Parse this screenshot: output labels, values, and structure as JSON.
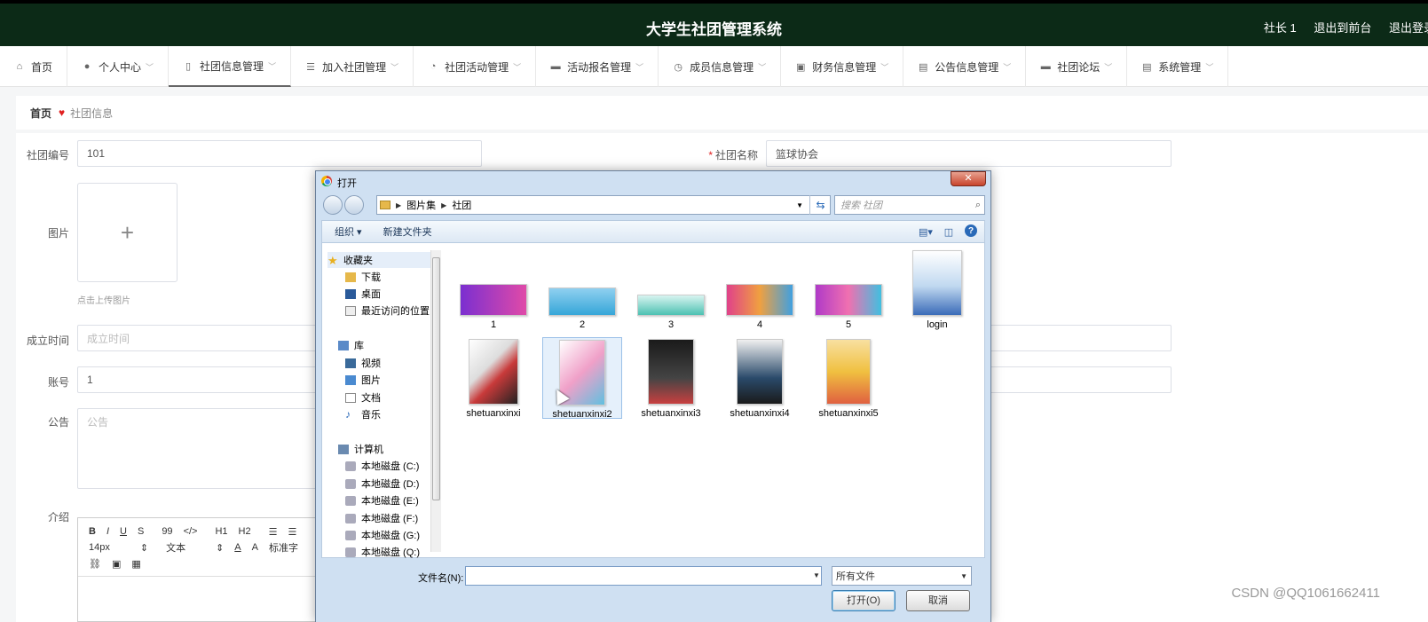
{
  "app": {
    "title": "大学生社团管理系统",
    "user_label": "社长 1",
    "front_link": "退出到前台",
    "logout_link": "退出登录"
  },
  "nav": [
    {
      "label": "首页",
      "icon": "home-icon"
    },
    {
      "label": "个人中心",
      "icon": "user-icon"
    },
    {
      "label": "社团信息管理",
      "icon": "mic-icon"
    },
    {
      "label": "加入社团管理",
      "icon": "list-icon"
    },
    {
      "label": "社团活动管理",
      "icon": "bell-icon"
    },
    {
      "label": "活动报名管理",
      "icon": "briefcase-icon"
    },
    {
      "label": "成员信息管理",
      "icon": "clock-icon"
    },
    {
      "label": "财务信息管理",
      "icon": "chart-icon"
    },
    {
      "label": "公告信息管理",
      "icon": "clipboard-icon"
    },
    {
      "label": "社团论坛",
      "icon": "chat-icon"
    },
    {
      "label": "系统管理",
      "icon": "clipboard-icon"
    }
  ],
  "breadcrumb": {
    "home": "首页",
    "current": "社团信息"
  },
  "form": {
    "club_no_label": "社团编号",
    "club_no_value": "101",
    "club_name_label": "社团名称",
    "club_name_value": "篮球协会",
    "image_label": "图片",
    "upload_hint": "点击上传图片",
    "found_time_label": "成立时间",
    "found_time_placeholder": "成立时间",
    "account_label": "账号",
    "account_value": "1",
    "notice_label": "公告",
    "notice_placeholder": "公告",
    "intro_label": "介绍"
  },
  "editor": {
    "row1": [
      "B",
      "I",
      "U",
      "S",
      "99",
      "</>",
      "H1",
      "H2",
      "☰",
      "☰"
    ],
    "font_size": "14px",
    "text_style": "文本",
    "normal_label": "标准字"
  },
  "dialog": {
    "title": "打开",
    "path": [
      "图片集",
      "社团"
    ],
    "search_placeholder": "搜索 社团",
    "organize": "组织 ▾",
    "new_folder": "新建文件夹",
    "tree": [
      {
        "label": "收藏夹",
        "icon": "star-icon"
      },
      {
        "label": "下载",
        "icon": "download-folder-icon"
      },
      {
        "label": "桌面",
        "icon": "desktop-icon"
      },
      {
        "label": "最近访问的位置",
        "icon": "recent-icon"
      },
      {
        "label": "库",
        "icon": "library-icon"
      },
      {
        "label": "视频",
        "icon": "video-icon"
      },
      {
        "label": "图片",
        "icon": "picture-icon"
      },
      {
        "label": "文档",
        "icon": "document-icon"
      },
      {
        "label": "音乐",
        "icon": "music-icon"
      },
      {
        "label": "计算机",
        "icon": "computer-icon"
      },
      {
        "label": "本地磁盘 (C:)",
        "icon": "drive-icon"
      },
      {
        "label": "本地磁盘 (D:)",
        "icon": "drive-icon"
      },
      {
        "label": "本地磁盘 (E:)",
        "icon": "drive-icon"
      },
      {
        "label": "本地磁盘 (F:)",
        "icon": "drive-icon"
      },
      {
        "label": "本地磁盘 (G:)",
        "icon": "drive-icon"
      },
      {
        "label": "本地磁盘 (Q:)",
        "icon": "drive-icon"
      }
    ],
    "files": [
      {
        "name": "1",
        "color": "#7b2fd0"
      },
      {
        "name": "2",
        "color": "#35a6d8"
      },
      {
        "name": "3",
        "color": "#4cc1b2"
      },
      {
        "name": "4",
        "color": "#e0418a"
      },
      {
        "name": "5",
        "color": "#b03ac8"
      },
      {
        "name": "login",
        "color": "#3a6bb8"
      },
      {
        "name": "shetuanxinxi",
        "color": "#c83a3a"
      },
      {
        "name": "shetuanxinxi2",
        "color": "#f0a0c8"
      },
      {
        "name": "shetuanxinxi3",
        "color": "#1a1a1a"
      },
      {
        "name": "shetuanxinxi4",
        "color": "#2a4a6a"
      },
      {
        "name": "shetuanxinxi5",
        "color": "#f0c040"
      }
    ],
    "filename_label": "文件名(N):",
    "filename_value": "",
    "filetype": "所有文件",
    "open_button": "打开(O)",
    "cancel_button": "取消"
  },
  "watermark": "CSDN @QQ1061662411"
}
